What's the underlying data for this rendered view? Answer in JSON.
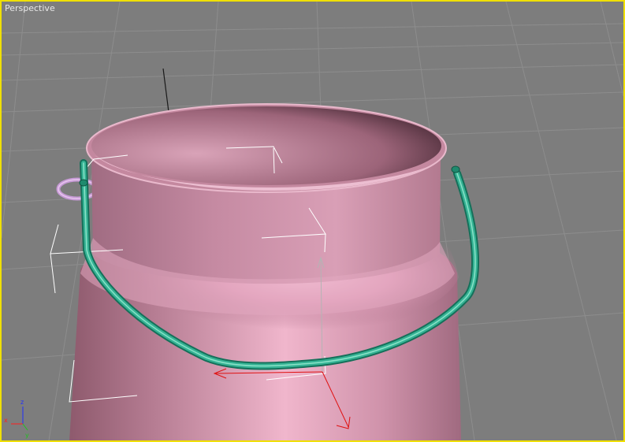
{
  "viewport": {
    "label": "Perspective"
  },
  "axis_tripod": {
    "x_label": "x",
    "y_label": "y",
    "z_label": "z"
  },
  "colors": {
    "viewport_border": "#f0e000",
    "viewport_bg": "#7d7d7d",
    "grid_line": "#8a8a8a",
    "object_pink": "#d9a0b6",
    "handle_teal": "#2fa286",
    "gizmo_red": "#e01010",
    "gizmo_gray": "#b4b4b4",
    "bracket_white": "#ffffff"
  }
}
